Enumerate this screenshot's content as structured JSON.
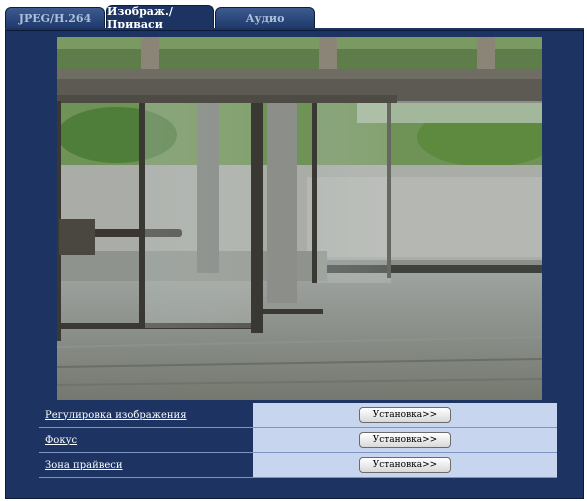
{
  "tabs": [
    {
      "label": "JPEG/H.264",
      "active": false
    },
    {
      "label": "Изображ./Приваси",
      "active": true
    },
    {
      "label": "Аудио",
      "active": false
    }
  ],
  "settings": [
    {
      "label": "Регулировка изображения",
      "button": "Установка>>"
    },
    {
      "label": "Фокус",
      "button": "Установка>>"
    },
    {
      "label": "Зона прайвеси",
      "button": "Установка>>"
    }
  ],
  "colors": {
    "panel": "#1d3463",
    "row_action_bg": "#c7d5ef"
  }
}
